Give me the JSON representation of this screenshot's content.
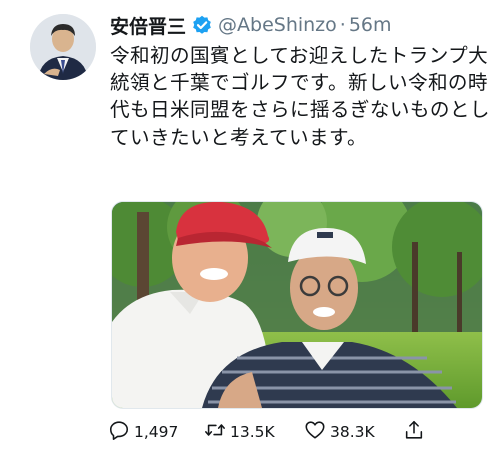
{
  "account": {
    "display_name": "安倍晋三",
    "handle": "@AbeShinzo",
    "separator": "·",
    "time": "56m"
  },
  "tweet": {
    "text": "令和初の国賓としてお迎えしたトランプ大統領と千葉でゴルフです。新しい令和の時代も日米同盟をさらに揺るぎないものとしていきたいと考えています。"
  },
  "actions": {
    "reply_count": "1,497",
    "retweet_count": "13.5K",
    "like_count": "38.3K"
  },
  "icons": {
    "verified": "verified-badge-icon",
    "reply": "reply-icon",
    "retweet": "retweet-icon",
    "like": "like-icon",
    "share": "share-icon"
  },
  "colors": {
    "verified_badge": "#1da1f2",
    "text": "#14171a",
    "secondary_text": "#657786"
  }
}
